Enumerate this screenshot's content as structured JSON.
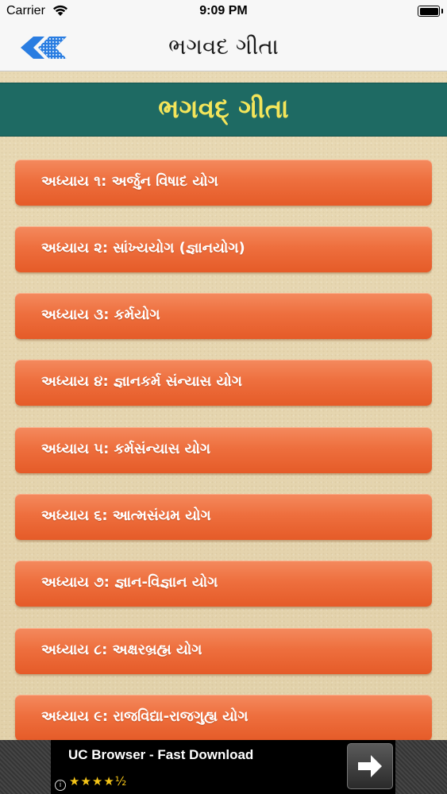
{
  "status_bar": {
    "carrier": "Carrier",
    "time": "9:09 PM"
  },
  "nav": {
    "title": "ભગવદ ગીતા",
    "back_icon": "back-arrow-icon",
    "accent_color": "#2a7de1"
  },
  "header": {
    "title": "ભગવદ્ ગીતા",
    "background_color": "#1e6a63",
    "text_color": "#f4e55a"
  },
  "chapters": [
    {
      "label": "અધ્યાય ૧: અર્જુન વિષાદ યોગ"
    },
    {
      "label": "અધ્યાય ૨: સાંખ્યયોગ (જ્ઞાનયોગ)"
    },
    {
      "label": "અધ્યાય ૩: કર્મયોગ"
    },
    {
      "label": "અધ્યાય ૪: જ્ઞાનકર્મ સંન્યાસ યોગ"
    },
    {
      "label": "અધ્યાય ૫: કર્મસંન્યાસ યોગ"
    },
    {
      "label": "અધ્યાય ૬: આત્મસંયમ યોગ"
    },
    {
      "label": "અધ્યાય ૭: જ્ઞાન-વિજ્ઞાન યોગ"
    },
    {
      "label": "અધ્યાય ૮: અક્ષરબ્રહ્મ યોગ"
    },
    {
      "label": "અધ્યાય ૯: રાજવિદ્યા-રાજગુહ્ય યોગ"
    }
  ],
  "ad": {
    "title": "UC Browser - Fast Download",
    "rating": "★★★★½",
    "info": "i",
    "arrow_icon": "arrow-right-icon"
  }
}
